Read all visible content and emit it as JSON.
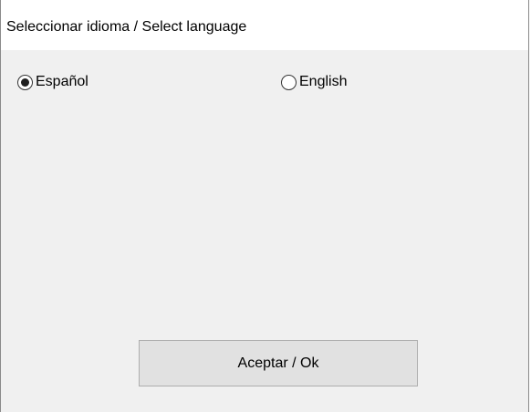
{
  "window": {
    "title": "Seleccionar idioma / Select language"
  },
  "language_options": [
    {
      "label": "Español",
      "selected": true
    },
    {
      "label": "English",
      "selected": false
    }
  ],
  "ok_button": {
    "label": "Aceptar / Ok"
  },
  "colors": {
    "titlebar_bg": "#ffffff",
    "client_bg": "#f0f0f0",
    "button_bg": "#e1e1e1",
    "button_border": "#adadad"
  }
}
